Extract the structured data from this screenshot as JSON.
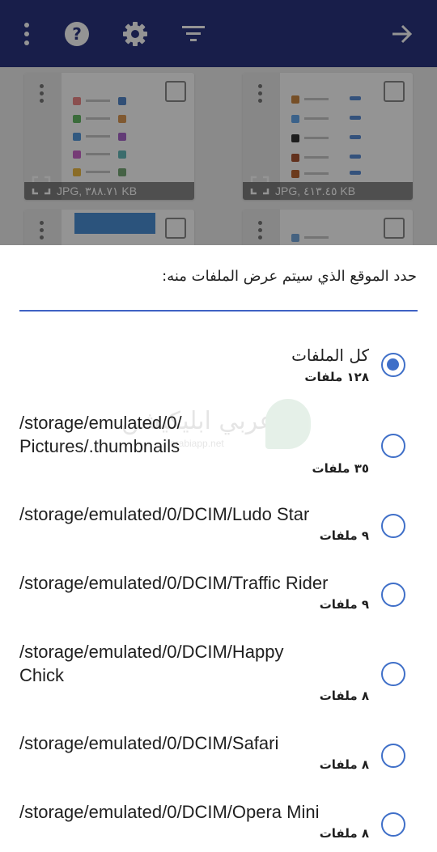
{
  "colors": {
    "appbar": "#2a3580",
    "accent": "#3f6fc8"
  },
  "toolbar": {
    "icons": [
      "more-vert-icon",
      "help-icon",
      "settings-icon",
      "filter-icon",
      "forward-arrow-icon"
    ]
  },
  "gallery": {
    "thumbs": [
      {
        "info": "JPG, ٣٨٨.٧١ KB"
      },
      {
        "info": "JPG, ٤١٣.٤٥ KB"
      }
    ]
  },
  "dialog": {
    "title": "حدد الموقع الذي سيتم عرض الملفات منه:",
    "watermark": "عربي ابليكيشن",
    "watermark_sub": "arabiapp.net",
    "options": [
      {
        "path": "كل الملفات",
        "count": "١٢٨ ملفات",
        "selected": true
      },
      {
        "path": "/storage/emulated/0/\nPictures/.thumbnails",
        "count": "٣٥ ملفات",
        "selected": false
      },
      {
        "path": "/storage/emulated/0/DCIM/Ludo Star",
        "count": "٩ ملفات",
        "selected": false
      },
      {
        "path": "/storage/emulated/0/DCIM/Traffic Rider",
        "count": "٩ ملفات",
        "selected": false
      },
      {
        "path": "/storage/emulated/0/DCIM/Happy\nChick",
        "count": "٨ ملفات",
        "selected": false
      },
      {
        "path": "/storage/emulated/0/DCIM/Safari",
        "count": "٨ ملفات",
        "selected": false
      },
      {
        "path": "/storage/emulated/0/DCIM/Opera Mini",
        "count": "٨ ملفات",
        "selected": false
      }
    ]
  }
}
